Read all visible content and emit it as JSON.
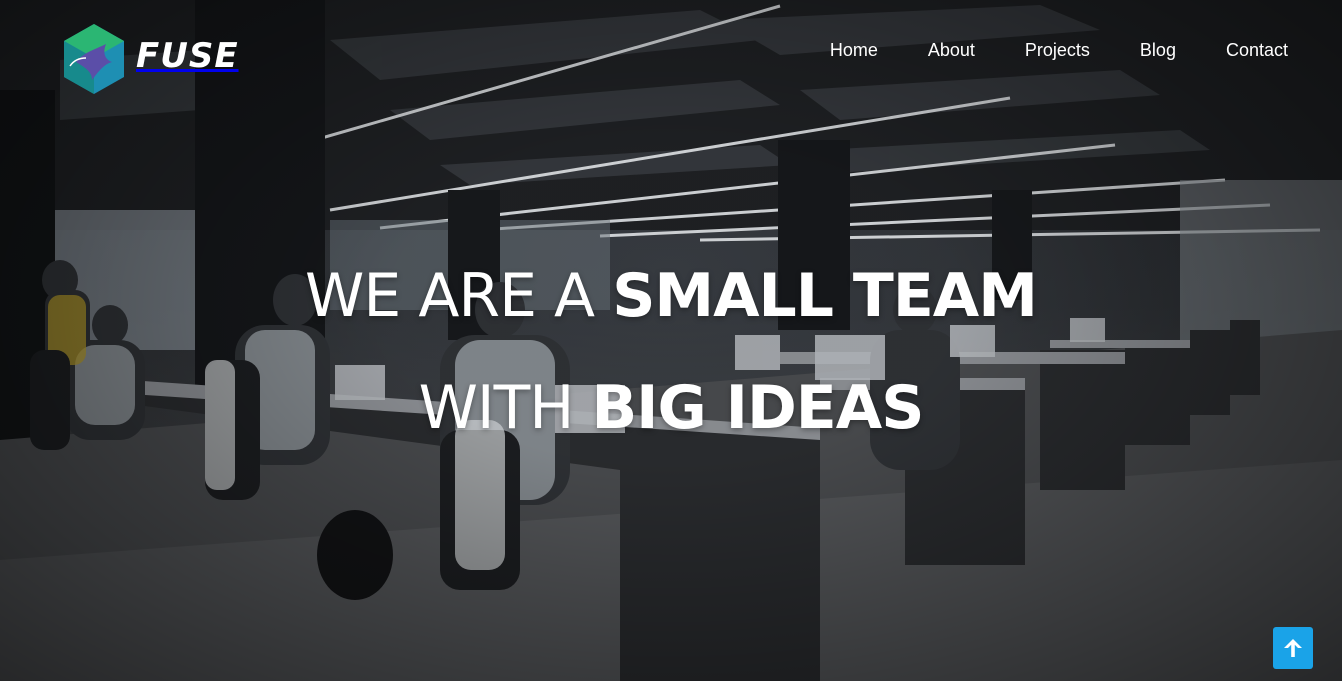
{
  "brand": {
    "name": "FUSE",
    "logo_icon": "fuse-hexagon-bird-logo",
    "colors": {
      "hex_green": "#2bb673",
      "hex_teal": "#1e8fb3",
      "bird_purple": "#5b4ea8"
    }
  },
  "nav": {
    "items": [
      {
        "label": "Home"
      },
      {
        "label": "About"
      },
      {
        "label": "Projects"
      },
      {
        "label": "Blog"
      },
      {
        "label": "Contact"
      }
    ]
  },
  "hero": {
    "line1_light": "WE ARE A ",
    "line1_bold": "SMALL TEAM",
    "line2_light": "WITH ",
    "line2_bold": "BIG IDEAS",
    "background": "open-plan-office-photo"
  },
  "scroll_top": {
    "icon": "arrow-up-icon",
    "color": "#1aa3e8"
  }
}
